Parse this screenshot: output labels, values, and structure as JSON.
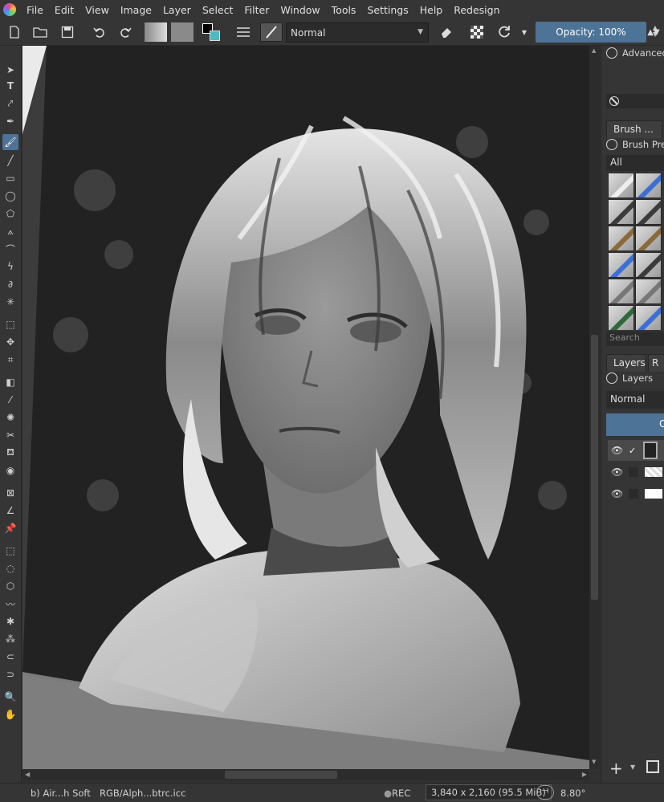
{
  "menubar": {
    "items": [
      "File",
      "Edit",
      "View",
      "Image",
      "Layer",
      "Select",
      "Filter",
      "Window",
      "Tools",
      "Settings",
      "Help",
      "Redesign"
    ]
  },
  "toolbar": {
    "blend_mode": "Normal",
    "opacity_label": "Opacity: 100%"
  },
  "dock": {
    "advanced_label": "Advanced",
    "brush_tab": "Brush ...",
    "brush_presets_title": "Brush Pre",
    "brush_filter": "All",
    "search_placeholder": "Search",
    "layers_tab": "Layers",
    "layers_tab2": "R",
    "layers_title": "Layers",
    "layer_blend": "Normal",
    "layer_opacity_partial": "O"
  },
  "status": {
    "brush_name": "b) Air...h Soft",
    "color_profile": "RGB/Alph...btrc.icc",
    "rec": "REC",
    "dimensions": "3,840 x 2,160 (95.5 MiB)",
    "rotation": "8.80°"
  },
  "colors": {
    "accent": "#4d7396",
    "bg": "#353535",
    "foreground_color": "#000000",
    "background_color": "#ffffff",
    "secondary_color": "#4fb8c0"
  }
}
